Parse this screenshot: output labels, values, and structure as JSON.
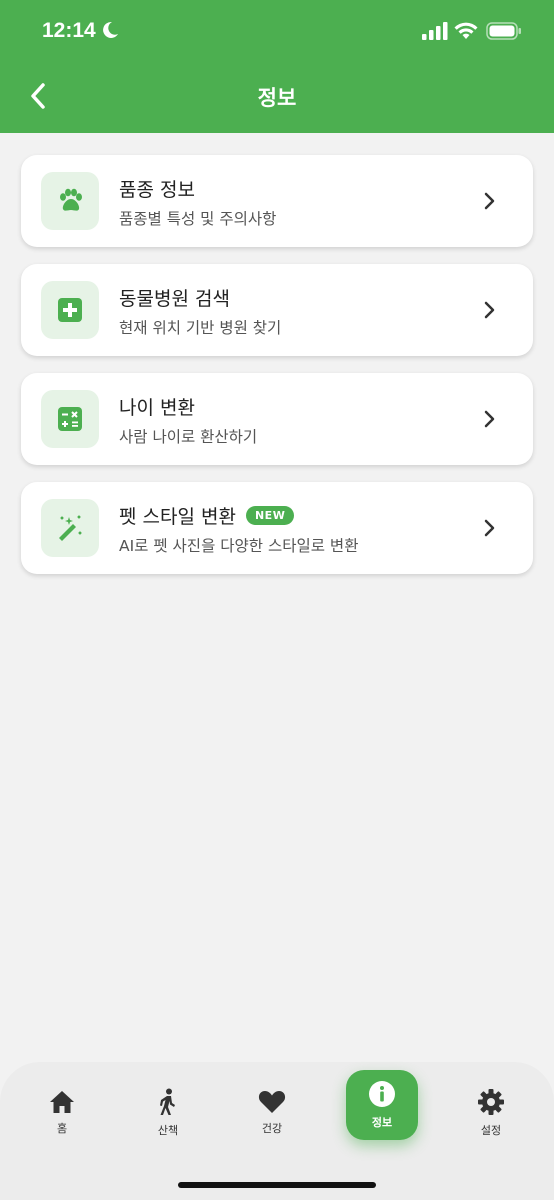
{
  "status_bar": {
    "time": "12:14"
  },
  "nav": {
    "title": "정보",
    "back_icon": "chevron-left-icon"
  },
  "colors": {
    "accent": "#4caf50",
    "icon_bg": "#e6f3e6",
    "background": "#f2f2f2"
  },
  "menu": [
    {
      "title": "품종 정보",
      "subtitle": "품종별 특성 및 주의사항",
      "icon": "paw-icon"
    },
    {
      "title": "동물병원 검색",
      "subtitle": "현재 위치 기반 병원 찾기",
      "icon": "medical-cross-icon"
    },
    {
      "title": "나이 변환",
      "subtitle": "사람 나이로 환산하기",
      "icon": "calculator-icon"
    },
    {
      "title": "펫 스타일 변환",
      "badge": "NEW",
      "subtitle": "AI로 펫 사진을 다양한 스타일로 변환",
      "icon": "magic-wand-icon"
    }
  ],
  "tabs": [
    {
      "label": "홈",
      "icon": "home-icon"
    },
    {
      "label": "산책",
      "icon": "walking-icon"
    },
    {
      "label": "건강",
      "icon": "heart-icon"
    },
    {
      "label": "정보",
      "icon": "info-icon",
      "active": true
    },
    {
      "label": "설정",
      "icon": "gear-icon"
    }
  ]
}
